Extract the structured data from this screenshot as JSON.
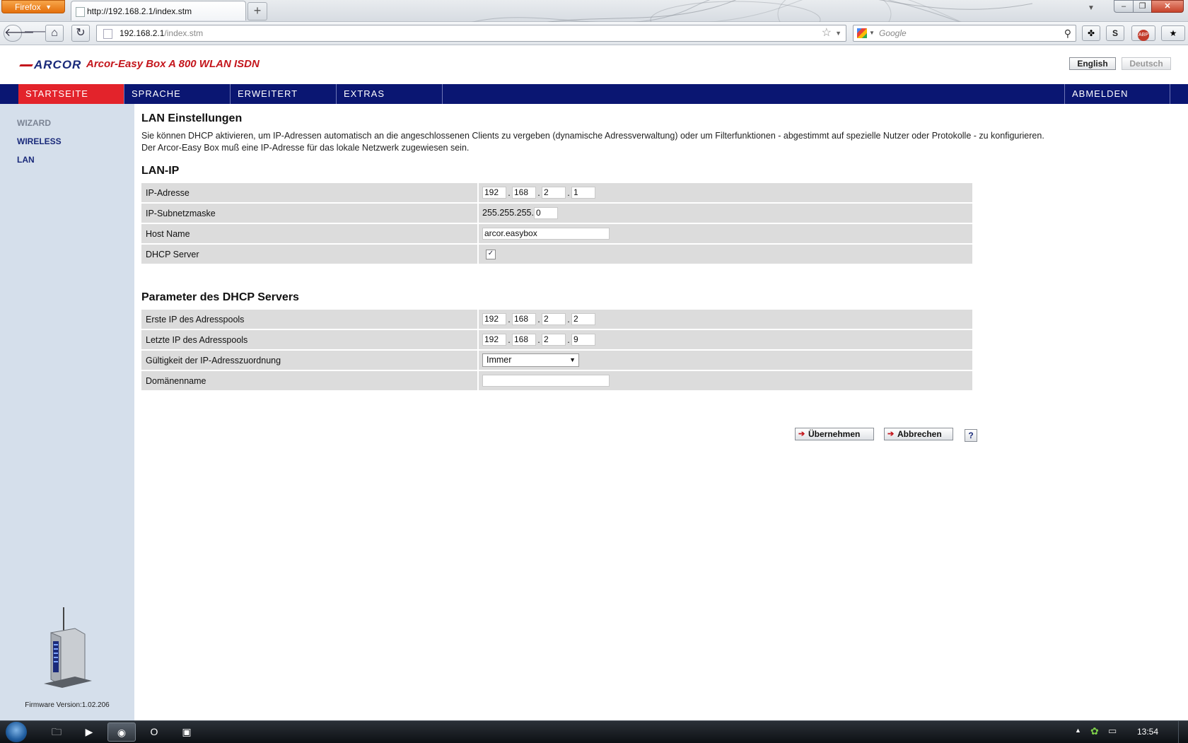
{
  "browser": {
    "app_button": "Firefox",
    "tab_title": "http://192.168.2.1/index.stm",
    "new_tab": "+",
    "url_host": "192.168.2.1",
    "url_path": "/index.stm",
    "search_placeholder": "Google",
    "addon_badge": "ABP"
  },
  "header": {
    "brand": "ARCOR",
    "product": "Arcor-Easy Box A 800 WLAN ISDN",
    "lang_english": "English",
    "lang_deutsch": "Deutsch"
  },
  "menu": {
    "start": "STARTSEITE",
    "sprache": "SPRACHE",
    "erweitert": "ERWEITERT",
    "extras": "EXTRAS",
    "abmelden": "ABMELDEN"
  },
  "sidebar": {
    "items": [
      {
        "label": "WIZARD"
      },
      {
        "label": "WIRELESS"
      },
      {
        "label": "LAN"
      }
    ],
    "firmware": "Firmware Version:1.02.206"
  },
  "main": {
    "title": "LAN Einstellungen",
    "desc_line1": "Sie können DHCP aktivieren, um IP-Adressen automatisch an die angeschlossenen Clients zu vergeben (dynamische Adressverwaltung) oder um Filterfunktionen - abgestimmt auf spezielle Nutzer oder Protokolle - zu konfigurieren.",
    "desc_line2": "Der Arcor-Easy Box muß eine IP-Adresse für das lokale Netzwerk zugewiesen sein.",
    "lan_ip": {
      "title": "LAN-IP",
      "ip_label": "IP-Adresse",
      "ip": [
        "192",
        "168",
        "2",
        "1"
      ],
      "subnet_label": "IP-Subnetzmaske",
      "subnet_prefix": "255.255.255.",
      "subnet_last": "0",
      "host_label": "Host Name",
      "host_value": "arcor.easybox",
      "dhcp_label": "DHCP Server",
      "dhcp_checked": "✓"
    },
    "dhcp": {
      "title": "Parameter des DHCP Servers",
      "first_label": "Erste IP des Adresspools",
      "first_ip": [
        "192",
        "168",
        "2",
        "2"
      ],
      "last_label": "Letzte IP des Adresspools",
      "last_ip": [
        "192",
        "168",
        "2",
        "9"
      ],
      "lease_label": "Gültigkeit der IP-Adresszuordnung",
      "lease_value": "Immer",
      "domain_label": "Domänenname",
      "domain_value": ""
    },
    "buttons": {
      "apply": "Übernehmen",
      "cancel": "Abbrechen",
      "help": "?"
    }
  },
  "taskbar": {
    "clock": "13:54"
  },
  "colors": {
    "menu_bg": "#0a1672",
    "menu_active": "#e3232b",
    "sidebar_bg": "#d5dfeb",
    "brand_red": "#c4161c",
    "brand_blue": "#1a2a7a"
  }
}
